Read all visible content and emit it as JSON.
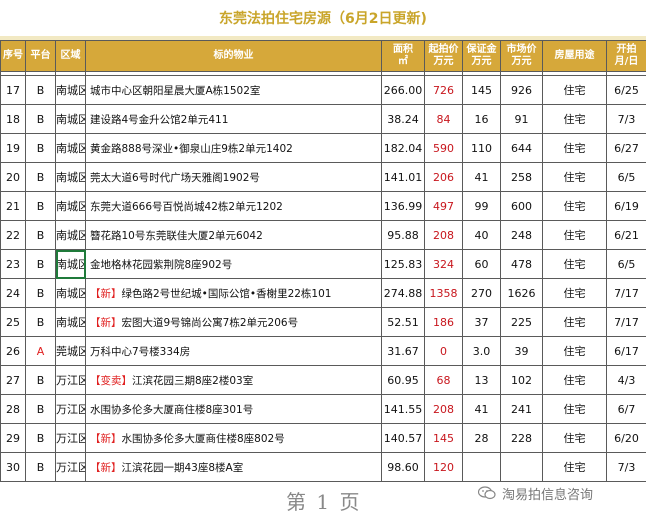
{
  "title": "东莞法拍住宅房源（6月2日更新)",
  "headers": {
    "no": "序号",
    "platform": "平台",
    "district": "区域",
    "property": "标的物业",
    "area_line1": "面积",
    "area_line2": "㎡",
    "start_line1": "起拍价",
    "start_line2": "万元",
    "deposit_line1": "保证金",
    "deposit_line2": "万元",
    "market_line1": "市场价",
    "market_line2": "万元",
    "use": "房屋用途",
    "open_line1": "开拍",
    "open_line2": "月/日"
  },
  "rows": [
    {
      "no": "17",
      "platform": "B",
      "district": "南城区",
      "tag": "",
      "property": "城市中心区朝阳星晨大厦A栋1502室",
      "area": "266.00",
      "start": "726",
      "deposit": "145",
      "market": "926",
      "use": "住宅",
      "open": "6/25"
    },
    {
      "no": "18",
      "platform": "B",
      "district": "南城区",
      "tag": "",
      "property": "建设路4号金升公馆2单元411",
      "area": "38.24",
      "start": "84",
      "deposit": "16",
      "market": "91",
      "use": "住宅",
      "open": "7/3"
    },
    {
      "no": "19",
      "platform": "B",
      "district": "南城区",
      "tag": "",
      "property": "黄金路888号深业•御泉山庄9栋2单元1402",
      "area": "182.04",
      "start": "590",
      "deposit": "110",
      "market": "644",
      "use": "住宅",
      "open": "6/27"
    },
    {
      "no": "20",
      "platform": "B",
      "district": "南城区",
      "tag": "",
      "property": "莞太大道6号时代广场天雅阁1902号",
      "area": "141.01",
      "start": "206",
      "deposit": "41",
      "market": "258",
      "use": "住宅",
      "open": "6/5"
    },
    {
      "no": "21",
      "platform": "B",
      "district": "南城区",
      "tag": "",
      "property": "东莞大道666号百悦尚城42栋2单元1202",
      "area": "136.99",
      "start": "497",
      "deposit": "99",
      "market": "600",
      "use": "住宅",
      "open": "6/19"
    },
    {
      "no": "22",
      "platform": "B",
      "district": "南城区",
      "tag": "",
      "property": "簪花路10号东莞联佳大厦2单元6042",
      "area": "95.88",
      "start": "208",
      "deposit": "40",
      "market": "248",
      "use": "住宅",
      "open": "6/21"
    },
    {
      "no": "23",
      "platform": "B",
      "district": "南城区",
      "tag": "",
      "property": "金地格林花园紫荆院8座902号",
      "area": "125.83",
      "start": "324",
      "deposit": "60",
      "market": "478",
      "use": "住宅",
      "open": "6/5"
    },
    {
      "no": "24",
      "platform": "B",
      "district": "南城区",
      "tag": "【新】",
      "property": "绿色路2号世纪城•国际公馆•香榭里22栋101",
      "area": "274.88",
      "start": "1358",
      "deposit": "270",
      "market": "1626",
      "use": "住宅",
      "open": "7/17"
    },
    {
      "no": "25",
      "platform": "B",
      "district": "南城区",
      "tag": "【新】",
      "property": "宏图大道9号锦尚公寓7栋2单元206号",
      "area": "52.51",
      "start": "186",
      "deposit": "37",
      "market": "225",
      "use": "住宅",
      "open": "7/17"
    },
    {
      "no": "26",
      "platform": "A",
      "district": "莞城区",
      "tag": "",
      "property": "万科中心7号楼334房",
      "area": "31.67",
      "start": "0",
      "deposit": "3.0",
      "market": "39",
      "use": "住宅",
      "open": "6/17"
    },
    {
      "no": "27",
      "platform": "B",
      "district": "万江区",
      "tag": "【变卖】",
      "property": "江滨花园三期8座2楼03室",
      "area": "60.95",
      "start": "68",
      "deposit": "13",
      "market": "102",
      "use": "住宅",
      "open": "4/3"
    },
    {
      "no": "28",
      "platform": "B",
      "district": "万江区",
      "tag": "",
      "property": "水围协多伦多大厦商住楼8座301号",
      "area": "141.55",
      "start": "208",
      "deposit": "41",
      "market": "241",
      "use": "住宅",
      "open": "6/7"
    },
    {
      "no": "29",
      "platform": "B",
      "district": "万江区",
      "tag": "【新】",
      "property": "水围协多伦多大厦商住楼8座802号",
      "area": "140.57",
      "start": "145",
      "deposit": "28",
      "market": "228",
      "use": "住宅",
      "open": "6/20"
    },
    {
      "no": "30",
      "platform": "B",
      "district": "万江区",
      "tag": "【新】",
      "property": "江滨花园一期43座8楼A室",
      "area": "98.60",
      "start": "120",
      "deposit": "",
      "market": "",
      "use": "住宅",
      "open": "7/3"
    }
  ],
  "page_mark": "第 1 页",
  "watermark": "淘易拍信息咨询",
  "colors": {
    "header_bg": "#d6a83a",
    "title_text": "#c9a52a",
    "price_red": "#c8161d",
    "tag_red": "#e02020"
  }
}
